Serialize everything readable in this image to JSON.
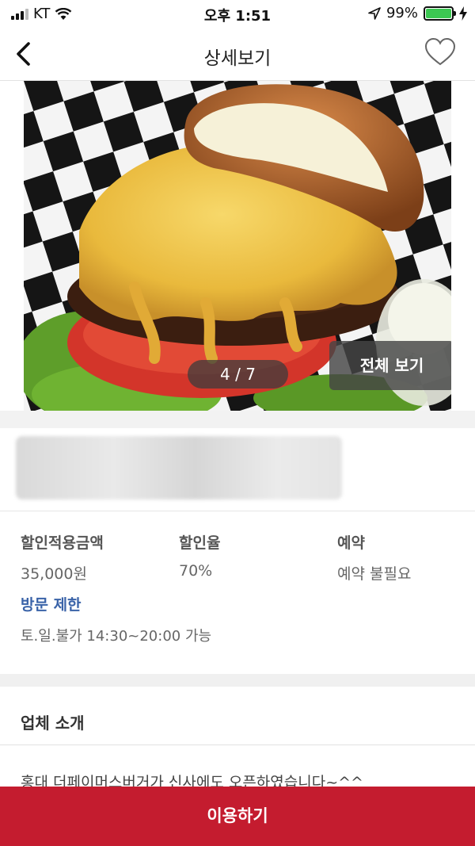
{
  "status_bar": {
    "carrier": "KT",
    "time": "오후 1:51",
    "battery": "99%",
    "battery_level": 0.99
  },
  "nav": {
    "title": "상세보기",
    "back_icon": "chevron-left-icon",
    "favorite_icon": "heart-outline-icon"
  },
  "gallery": {
    "counter": "4 / 7",
    "view_all_label": "전체 보기"
  },
  "details": {
    "discount_amount_label": "할인적용금액",
    "discount_amount_value": "35,000원",
    "discount_rate_label": "할인율",
    "discount_rate_value": "70%",
    "reservation_label": "예약",
    "reservation_value": "예약 불필요",
    "visit_limit_label": "방문 제한",
    "visit_limit_value": "토.일.불가 14:30~20:00 가능"
  },
  "intro": {
    "title": "업체 소개",
    "text": "홍대 더페이머스버거가 신사에도 오픈하였습니다~^^"
  },
  "cta": {
    "label": "이용하기"
  },
  "colors": {
    "accent": "#c41c2f",
    "link_blue": "#3a63a8",
    "battery_green": "#3cc752"
  }
}
